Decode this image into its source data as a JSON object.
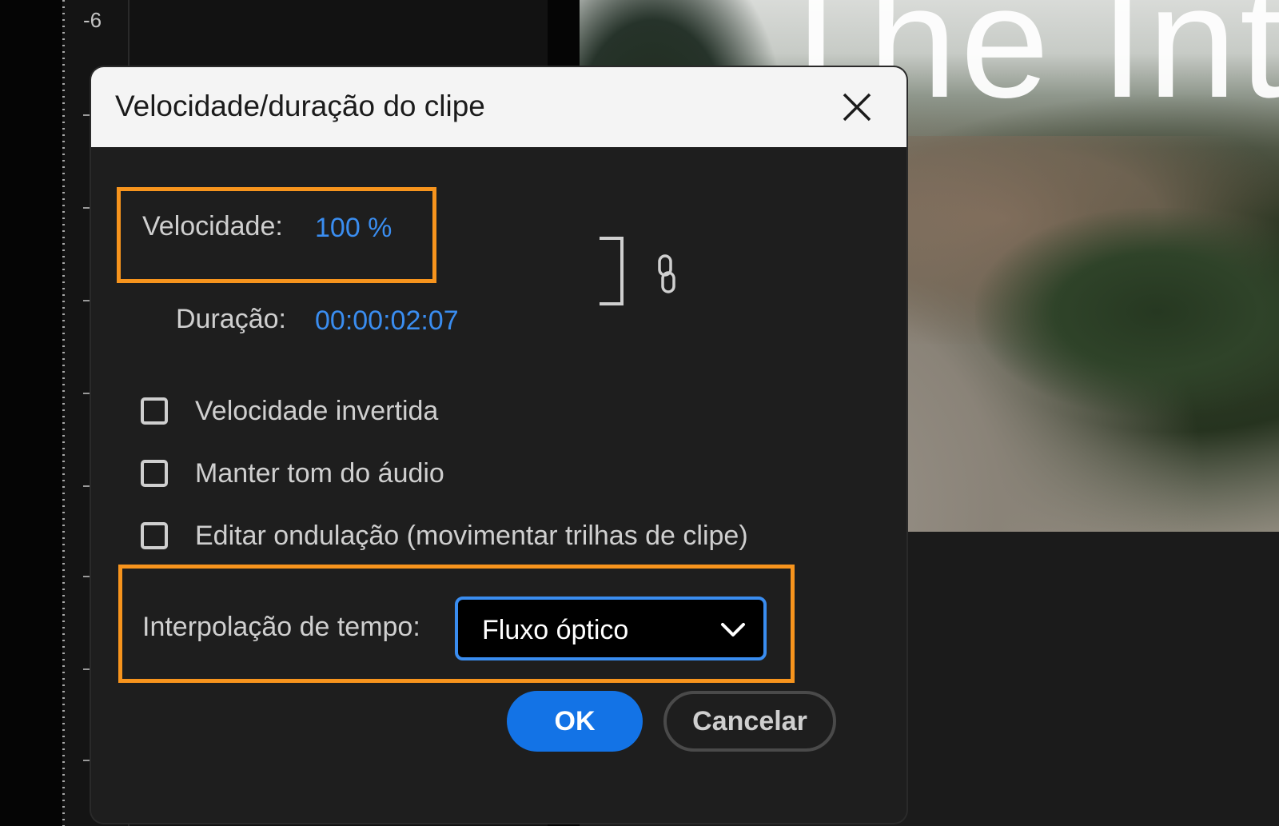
{
  "timeline": {
    "ruler_label": "-6"
  },
  "video": {
    "title_text": "The Int"
  },
  "dialog": {
    "title": "Velocidade/duração do clipe",
    "close_icon": "close-icon",
    "speed": {
      "label": "Velocidade:",
      "value": "100 %"
    },
    "duration": {
      "label": "Duração:",
      "value": "00:00:02:07"
    },
    "link_icon": "chain-link-icon",
    "checkboxes": [
      {
        "label": "Velocidade invertida",
        "checked": false
      },
      {
        "label": "Manter tom do áudio",
        "checked": false
      },
      {
        "label": "Editar ondulação (movimentar trilhas de clipe)",
        "checked": false
      }
    ],
    "interpolation": {
      "label": "Interpolação de tempo:",
      "selected": "Fluxo óptico",
      "chevron_icon": "chevron-down-icon"
    },
    "buttons": {
      "ok": "OK",
      "cancel": "Cancelar"
    }
  },
  "colors": {
    "highlight": "#f7941d",
    "accent": "#1373e6",
    "link_value": "#3a8df0",
    "dialog_bg": "#1e1e1e",
    "titlebar_bg": "#f4f4f4"
  }
}
